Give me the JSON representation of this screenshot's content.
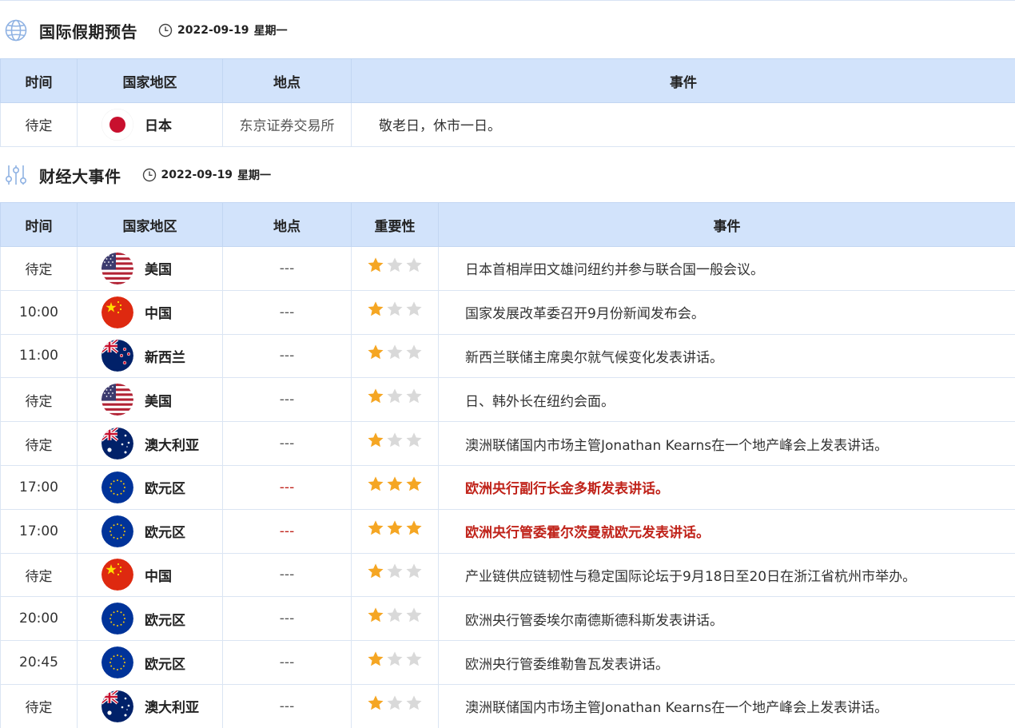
{
  "holiday": {
    "title": "国际假期预告",
    "date": "2022-09-19",
    "weekday": "星期一",
    "columns": [
      "时间",
      "国家地区",
      "地点",
      "事件"
    ],
    "rows": [
      {
        "time": "待定",
        "flag": "jp",
        "country": "日本",
        "place": "东京证券交易所",
        "event": "敬老日，休市一日。"
      }
    ]
  },
  "events": {
    "title": "财经大事件",
    "date": "2022-09-19",
    "weekday": "星期一",
    "columns": [
      "时间",
      "国家地区",
      "地点",
      "重要性",
      "事件"
    ],
    "rows": [
      {
        "time": "待定",
        "flag": "us",
        "country": "美国",
        "place": "---",
        "stars": 1,
        "important": false,
        "event": "日本首相岸田文雄问纽约并参与联合国一般会议。"
      },
      {
        "time": "10:00",
        "flag": "cn",
        "country": "中国",
        "place": "---",
        "stars": 1,
        "important": false,
        "event": "国家发展改革委召开9月份新闻发布会。"
      },
      {
        "time": "11:00",
        "flag": "nz",
        "country": "新西兰",
        "place": "---",
        "stars": 1,
        "important": false,
        "event": "新西兰联储主席奥尔就气候变化发表讲话。"
      },
      {
        "time": "待定",
        "flag": "us",
        "country": "美国",
        "place": "---",
        "stars": 1,
        "important": false,
        "event": "日、韩外长在纽约会面。"
      },
      {
        "time": "待定",
        "flag": "au",
        "country": "澳大利亚",
        "place": "---",
        "stars": 1,
        "important": false,
        "event": "澳洲联储国内市场主管Jonathan Kearns在一个地产峰会上发表讲话。"
      },
      {
        "time": "17:00",
        "flag": "eu",
        "country": "欧元区",
        "place": "---",
        "stars": 3,
        "important": true,
        "event": "欧洲央行副行长金多斯发表讲话。"
      },
      {
        "time": "17:00",
        "flag": "eu",
        "country": "欧元区",
        "place": "---",
        "stars": 3,
        "important": true,
        "event": "欧洲央行管委霍尔茨曼就欧元发表讲话。"
      },
      {
        "time": "待定",
        "flag": "cn",
        "country": "中国",
        "place": "---",
        "stars": 1,
        "important": false,
        "event": "产业链供应链韧性与稳定国际论坛于9月18日至20日在浙江省杭州市举办。"
      },
      {
        "time": "20:00",
        "flag": "eu",
        "country": "欧元区",
        "place": "---",
        "stars": 1,
        "important": false,
        "event": "欧洲央行管委埃尔南德斯德科斯发表讲话。"
      },
      {
        "time": "20:45",
        "flag": "eu",
        "country": "欧元区",
        "place": "---",
        "stars": 1,
        "important": false,
        "event": "欧洲央行管委维勒鲁瓦发表讲话。"
      },
      {
        "time": "待定",
        "flag": "au",
        "country": "澳大利亚",
        "place": "---",
        "stars": 1,
        "important": false,
        "event": "澳洲联储国内市场主管Jonathan Kearns在一个地产峰会上发表讲话。"
      }
    ]
  },
  "colors": {
    "header_bg": "#d2e3fb",
    "important_text": "#c0231a",
    "star_on": "#f5a623",
    "star_off": "#d9d9d9"
  },
  "icons": {
    "holiday_section": "globe-icon",
    "events_section": "sliders-icon",
    "date": "clock-icon",
    "importance": "star-icon"
  }
}
